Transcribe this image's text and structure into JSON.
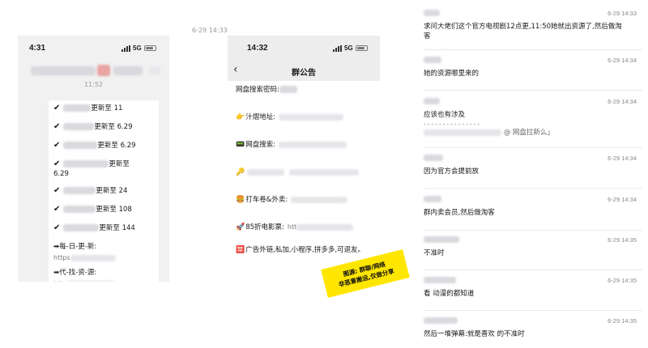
{
  "left_timestamp": "6-29 14:33",
  "phone1": {
    "time": "4:31",
    "network": "5G",
    "stamp": "11:52",
    "updates": [
      {
        "text": "更新至 11"
      },
      {
        "text": "更新至 6.29"
      },
      {
        "text": "更新至 6.29"
      },
      {
        "text": "更新至",
        "extra": "6.29"
      },
      {
        "text": "更新至 24"
      },
      {
        "text": "更新至 108"
      },
      {
        "text": "更新至 144"
      }
    ],
    "daily_label": "➡每-日-更-新:",
    "daily_url": "https",
    "find_label": "➡代-找-资-源:",
    "find_url": "http"
  },
  "phone2": {
    "time": "14:32",
    "network": "5G",
    "title": "群公告",
    "lines": [
      {
        "emoji": "",
        "label": "网盘搜索密码:"
      },
      {
        "emoji": "👉",
        "label": "汁熠地址:"
      },
      {
        "emoji": "📟",
        "label": "网盘搜索:"
      },
      {
        "emoji": "🔑",
        "label": ""
      },
      {
        "emoji": "🍔",
        "label": "打车卷&外卖:"
      },
      {
        "emoji": "🚀",
        "label": "85折电影票:",
        "url": "htt"
      },
      {
        "emoji": "🈲",
        "label": "广告外链,私加,小程序,拼多多,可退友。"
      }
    ]
  },
  "banner": {
    "line1": "图源: 群聊/网络",
    "line2": "非恶意搬运,仅做分享"
  },
  "chat": [
    {
      "ts": "6-29 14:33",
      "text": "求问大佬们这个官方电视剧12点更,11:50她就出资源了,然后做淘客"
    },
    {
      "ts": "6-29 14:34",
      "text": "她的资源哪里来的"
    },
    {
      "ts": "6-29 14:34",
      "text": "应该也有涉及",
      "dashes": "- - - - - - - - - - - - - - -",
      "quote": "@  网盘拉新么」"
    },
    {
      "ts": "6-29 14:34",
      "text": "因为官方会提前放"
    },
    {
      "ts": "6-29 14:34",
      "text": "群内卖会员,然后做淘客"
    },
    {
      "ts": "6-29 14:35",
      "text": "不准时"
    },
    {
      "ts": "6-29 14:35",
      "text": "看   动漫的都知道"
    },
    {
      "ts": "6-29 14:35",
      "text": "然后一堆弹幕:就是喜欢   的不准时"
    }
  ]
}
